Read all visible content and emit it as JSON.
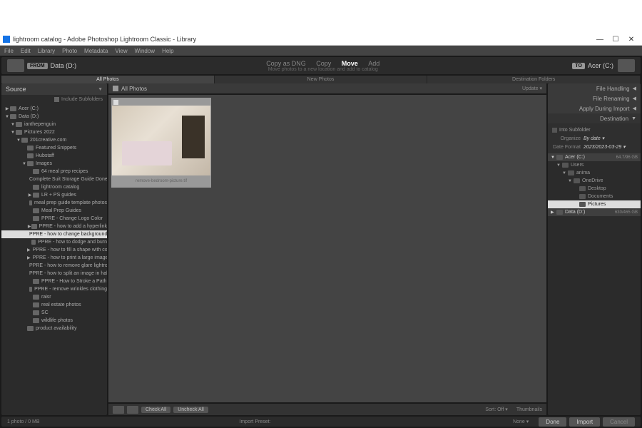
{
  "window": {
    "title": "lightroom catalog - Adobe Photoshop Lightroom Classic - Library",
    "min": "—",
    "max": "☐",
    "close": "✕"
  },
  "menu": [
    "File",
    "Edit",
    "Library",
    "Photo",
    "Metadata",
    "View",
    "Window",
    "Help"
  ],
  "topstrip": {
    "from_badge": "FROM",
    "from_drive": "Data (D:)",
    "actions": {
      "copy_dng": "Copy as DNG",
      "copy": "Copy",
      "move": "Move",
      "add": "Add"
    },
    "sub": "Move photos to a new location and add to catalog",
    "to_badge": "TO",
    "to_drive": "Acer (C:)"
  },
  "filter_tabs": {
    "all": "All Photos",
    "new": "New Photos",
    "dest": "Destination Folders"
  },
  "source": {
    "heading": "Source",
    "include_sub": "Include Subfolders",
    "tree": [
      {
        "d": 0,
        "arr": "▶",
        "t": "Acer (C:)"
      },
      {
        "d": 0,
        "arr": "▼",
        "t": "Data (D:)"
      },
      {
        "d": 1,
        "arr": "▼",
        "t": "ianthepenguin"
      },
      {
        "d": 1,
        "arr": "▼",
        "t": "Pictures 2022"
      },
      {
        "d": 2,
        "arr": "▼",
        "t": "201creative.com"
      },
      {
        "d": 3,
        "arr": "",
        "t": "Featured Snippets"
      },
      {
        "d": 3,
        "arr": "",
        "t": "Hubstaff"
      },
      {
        "d": 3,
        "arr": "▼",
        "t": "Images"
      },
      {
        "d": 4,
        "arr": "",
        "t": "64 meal prep recipes"
      },
      {
        "d": 4,
        "arr": "",
        "t": "Complete Suit Storage Guide Done Saf…"
      },
      {
        "d": 4,
        "arr": "",
        "t": "lightroom catalog"
      },
      {
        "d": 4,
        "arr": "▶",
        "t": "LR + PS guides"
      },
      {
        "d": 4,
        "arr": "",
        "t": "meal prep guide template photos"
      },
      {
        "d": 4,
        "arr": "",
        "t": "Meal Prep Guides"
      },
      {
        "d": 4,
        "arr": "",
        "t": "PPRE - Change Logo Color"
      },
      {
        "d": 4,
        "arr": "▶",
        "t": "PPRE - how to add a hyperlink"
      },
      {
        "d": 4,
        "arr": "",
        "t": "PPRE - how to change background col…",
        "sel": true
      },
      {
        "d": 4,
        "arr": "",
        "t": "PPRE - how to dodge and burn"
      },
      {
        "d": 4,
        "arr": "▶",
        "t": "PPRE - how to fill a shape with color"
      },
      {
        "d": 4,
        "arr": "▶",
        "t": "PPRE - how to print a large image on …"
      },
      {
        "d": 4,
        "arr": "",
        "t": "PPRE - how to remove glare lightroom"
      },
      {
        "d": 4,
        "arr": "",
        "t": "PPRE - how to split an image in half"
      },
      {
        "d": 4,
        "arr": "",
        "t": "PPRE - How to Stroke a Path"
      },
      {
        "d": 4,
        "arr": "",
        "t": "PPRE - remove wrinkles clothing"
      },
      {
        "d": 4,
        "arr": "",
        "t": "raisr"
      },
      {
        "d": 4,
        "arr": "",
        "t": "real estate photos"
      },
      {
        "d": 4,
        "arr": "",
        "t": "SC"
      },
      {
        "d": 4,
        "arr": "",
        "t": "wildlife photos"
      },
      {
        "d": 3,
        "arr": "",
        "t": "product availability"
      }
    ]
  },
  "grid": {
    "head": "All Photos",
    "update": "Update ▾",
    "caption": "remove-bedroom-picture.tif",
    "check_all": "Check All",
    "uncheck_all": "Uncheck All",
    "sort": "Sort:  Off ▾",
    "thumbs": "Thumbnails"
  },
  "right": {
    "panels": [
      "File Handling",
      "File Renaming",
      "Apply During Import",
      "Destination"
    ],
    "into_sub": "Into Subfolder",
    "organize_l": "Organize",
    "organize_v": "By date  ▾",
    "datefmt_l": "Date Format",
    "datefmt_v": "2023/2023-03-29  ▾",
    "dtree": [
      {
        "d": 0,
        "t": "Acer (C:)",
        "sz": "64.7/96 GB",
        "bar": true,
        "arr": "▼"
      },
      {
        "d": 1,
        "t": "Users",
        "arr": "▼"
      },
      {
        "d": 2,
        "t": "anima",
        "arr": "▼"
      },
      {
        "d": 3,
        "t": "OneDrive",
        "arr": "▼"
      },
      {
        "d": 4,
        "t": "Desktop",
        "arr": ""
      },
      {
        "d": 4,
        "t": "Documents",
        "arr": ""
      },
      {
        "d": 4,
        "t": "Pictures",
        "arr": "",
        "hl": true
      },
      {
        "d": 0,
        "t": "Data (D:)",
        "sz": "630/465 GB",
        "bar": true,
        "arr": "▶"
      }
    ]
  },
  "status": {
    "left": "1 photo / 0 MB",
    "preset": "Import Preset:",
    "none": "None ▾",
    "done": "Done",
    "import": "Import",
    "cancel": "Cancel"
  }
}
